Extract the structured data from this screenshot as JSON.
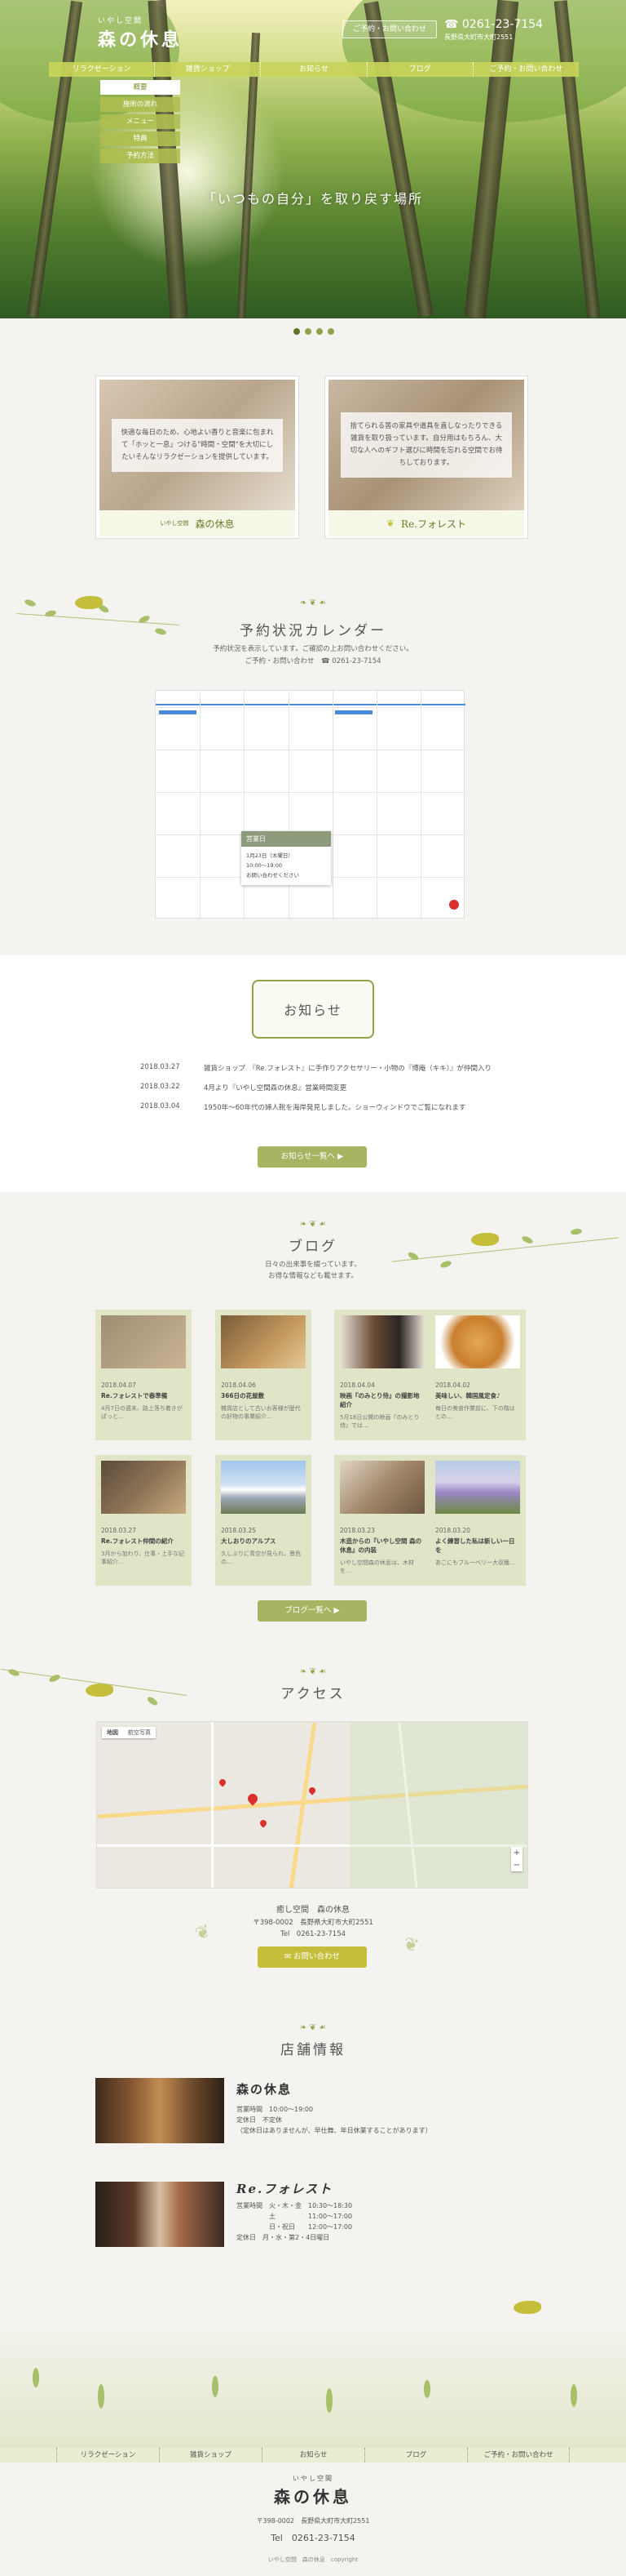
{
  "header": {
    "logo_sub": "いやし空間",
    "logo_main": "森の休息",
    "contact_button": "ご予約・お問い合わせ",
    "tel": "☎ 0261-23-7154",
    "address": "長野県大町市大町2551"
  },
  "nav": [
    "リラクゼーション",
    "雑貨ショップ",
    "お知らせ",
    "ブログ",
    "ご予約・お問い合わせ"
  ],
  "dropdown": [
    "概要",
    "施術の流れ",
    "メニュー",
    "特典",
    "予約方法"
  ],
  "hero": {
    "catch": "「いつもの自分」を取り戻す場所"
  },
  "brands": [
    {
      "text": "快適な毎日のため、心地よい香りと音楽に包まれて「ホッと一息」つける\"時間・空間\"を大切にしたいそんなリラクゼーションを提供しています。",
      "logo_sub": "いやし空間",
      "logo": "森の休息"
    },
    {
      "text": "捨てられる筈の家具や道具を直しなったりできる雑貨を取り扱っています。自分用はもちろん、大切な人へのギフト選びに時間を忘れる空間でお待ちしております。",
      "logo": "Re.フォレスト"
    }
  ],
  "calendar": {
    "title": "予約状況カレンダー",
    "desc": "予約状況を表示しています。ご確認の上お問い合わせください。",
    "contact": "ご予約・お問い合わせ",
    "tel": "☎ 0261-23-7154",
    "popup_title": "営業日",
    "popup_lines": [
      "1月23日（木曜日）",
      "10:00～19:00",
      "お問い合わせください"
    ]
  },
  "news": {
    "title": "お知らせ",
    "items": [
      {
        "date": "2018.03.27",
        "text": "雑貨ショップ　『Re.フォレスト』に手作りアクセサリー・小物の『博庵（キキ）』が仲間入り"
      },
      {
        "date": "2018.03.22",
        "text": "4月より『いやし空間森の休息』営業時間変更"
      },
      {
        "date": "2018.03.04",
        "text": "1950年～60年代の婦人靴を海岸発見しました。ショーウィンドウでご覧になれます"
      }
    ],
    "more": "お知らせ一覧へ ▶"
  },
  "blog": {
    "title": "ブログ",
    "desc": [
      "日々の出来事を綴っています。",
      "お得な情報なども載せます。"
    ],
    "posts": [
      {
        "date": "2018.04.07",
        "title": "Re.フォレストで春準備",
        "excerpt": "4月7日の週末、路上落ち着きがぱっと…"
      },
      {
        "date": "2018.04.06",
        "title": "366日の花屋敷",
        "excerpt": "雑貨店として古いお客様が歴代の好物の事業紹介…"
      },
      {
        "date": "2018.04.04",
        "title": "映画『のみとり侍』の撮影地紹介",
        "excerpt": "5月18日公開の映画『のみとり侍』では…"
      },
      {
        "date": "2018.04.02",
        "title": "美味しい、韓国風定食♪",
        "excerpt": "毎日の美食作業前に、下の階はとの…"
      },
      {
        "date": "2018.03.27",
        "title": "Re.フォレスト仲間の紹介",
        "excerpt": "3月から加わり、仕事・上手な記事紹介…"
      },
      {
        "date": "2018.03.25",
        "title": "大しおりのアルプス",
        "excerpt": "久しぶりに青空が見られ、景色の…"
      },
      {
        "date": "2018.03.23",
        "title": "木造からの『いやし空間 森の休息』の内装",
        "excerpt": "いやし空間森の休息は、木材を…"
      },
      {
        "date": "2018.03.20",
        "title": "よく練習した私は新しい一日を",
        "excerpt": "あこにもブルーベリー大収穫…"
      }
    ],
    "more": "ブログ一覧へ ▶"
  },
  "access": {
    "title": "アクセス",
    "name": "癒し空間　森の休息",
    "address": "〒398-0002　長野県大町市大町2551",
    "tel": "Tel　0261-23-7154",
    "contact": "✉ お問い合わせ",
    "map_tabs": [
      "地図",
      "航空写真"
    ]
  },
  "shops": {
    "title": "店舗情報",
    "items": [
      {
        "logo": "森の休息",
        "lines": [
          "営業時間　10:00～19:00",
          "定休日　不定休",
          "（定休日はありませんが、早仕舞、年日休業することがあります）"
        ]
      },
      {
        "logo": "Re.フォレスト",
        "lines": [
          "営業時間　火・木・金　10:30～18:30",
          "　　　　　土　　　　　11:00～17:00",
          "　　　　　日・祝日　　12:00～17:00",
          "定休日　月・水・第2・4日曜日"
        ]
      }
    ]
  },
  "footer": {
    "nav": [
      "リラクゼーション",
      "雑貨ショップ",
      "お知らせ",
      "ブログ",
      "ご予約・お問い合わせ"
    ],
    "logo_sub": "いやし空間",
    "logo": "森の休息",
    "address": "〒398-0002　長野県大町市大町2551",
    "tel": "Tel　0261-23-7154",
    "copyright": "いやし空間　森の休息　copyright"
  },
  "colors": {
    "accent": "#a7b462",
    "nav": "#c8d45a",
    "text": "#555555"
  }
}
